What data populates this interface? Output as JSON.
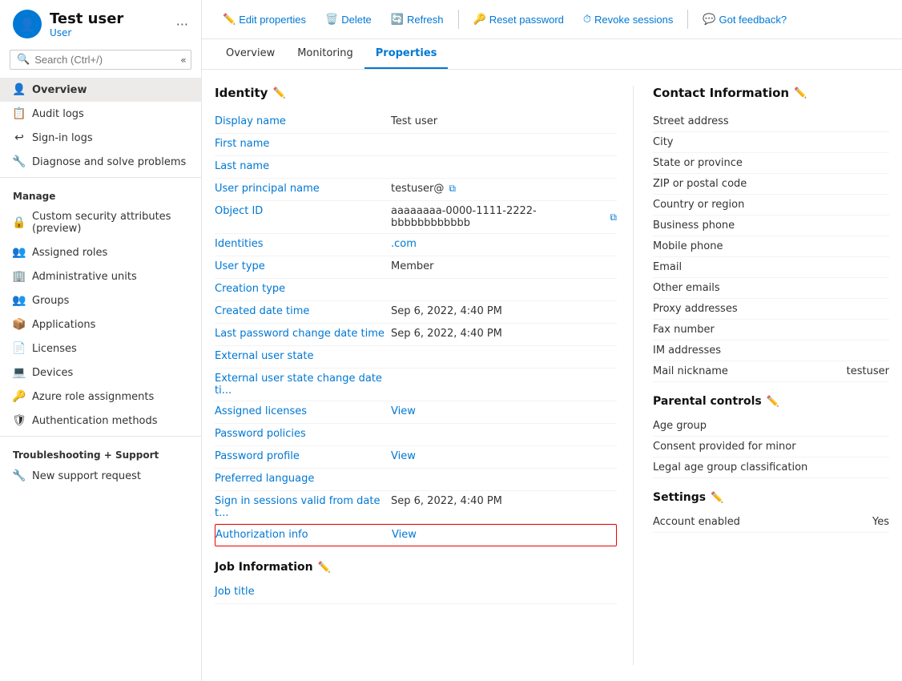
{
  "sidebar": {
    "username": "Test user",
    "subtitle": "User",
    "more_icon": "···",
    "search_placeholder": "Search (Ctrl+/)",
    "nav_items": [
      {
        "id": "overview",
        "label": "Overview",
        "icon": "👤",
        "active": true
      },
      {
        "id": "audit-logs",
        "label": "Audit logs",
        "icon": "📋",
        "active": false
      },
      {
        "id": "sign-in-logs",
        "label": "Sign-in logs",
        "icon": "↩",
        "active": false
      },
      {
        "id": "diagnose",
        "label": "Diagnose and solve problems",
        "icon": "🔧",
        "active": false
      }
    ],
    "manage_label": "Manage",
    "manage_items": [
      {
        "id": "custom-security",
        "label": "Custom security attributes (preview)",
        "icon": "🔒"
      },
      {
        "id": "assigned-roles",
        "label": "Assigned roles",
        "icon": "👥"
      },
      {
        "id": "admin-units",
        "label": "Administrative units",
        "icon": "🏢"
      },
      {
        "id": "groups",
        "label": "Groups",
        "icon": "👥"
      },
      {
        "id": "applications",
        "label": "Applications",
        "icon": "📦"
      },
      {
        "id": "licenses",
        "label": "Licenses",
        "icon": "📄"
      },
      {
        "id": "devices",
        "label": "Devices",
        "icon": "💻"
      },
      {
        "id": "azure-roles",
        "label": "Azure role assignments",
        "icon": "🔑"
      },
      {
        "id": "auth-methods",
        "label": "Authentication methods",
        "icon": "🛡"
      }
    ],
    "support_label": "Troubleshooting + Support",
    "support_items": [
      {
        "id": "new-support",
        "label": "New support request",
        "icon": "🔧"
      }
    ]
  },
  "toolbar": {
    "edit_label": "Edit properties",
    "delete_label": "Delete",
    "refresh_label": "Refresh",
    "reset_password_label": "Reset password",
    "revoke_sessions_label": "Revoke sessions",
    "feedback_label": "Got feedback?"
  },
  "tabs": [
    {
      "id": "overview",
      "label": "Overview",
      "active": false
    },
    {
      "id": "monitoring",
      "label": "Monitoring",
      "active": false
    },
    {
      "id": "properties",
      "label": "Properties",
      "active": true
    }
  ],
  "identity": {
    "section_title": "Identity",
    "fields": [
      {
        "label": "Display name",
        "value": "Test user",
        "link": false,
        "copy": false
      },
      {
        "label": "First name",
        "value": "",
        "link": false,
        "copy": false
      },
      {
        "label": "Last name",
        "value": "",
        "link": false,
        "copy": false
      },
      {
        "label": "User principal name",
        "value": "testuser@",
        "link": false,
        "copy": true
      },
      {
        "label": "Object ID",
        "value": "aaaaaaaa-0000-1111-2222-bbbbbbbbbbbb",
        "link": false,
        "copy": true
      },
      {
        "label": "Identities",
        "value": ".com",
        "link": false,
        "copy": false,
        "special": "identities"
      },
      {
        "label": "User type",
        "value": "Member",
        "link": false,
        "copy": false
      },
      {
        "label": "Creation type",
        "value": "",
        "link": false,
        "copy": false
      },
      {
        "label": "Created date time",
        "value": "Sep 6, 2022, 4:40 PM",
        "link": false,
        "copy": false
      },
      {
        "label": "Last password change date time",
        "value": "Sep 6, 2022, 4:40 PM",
        "link": false,
        "copy": false
      },
      {
        "label": "External user state",
        "value": "",
        "link": false,
        "copy": false
      },
      {
        "label": "External user state change date ti...",
        "value": "",
        "link": false,
        "copy": false
      },
      {
        "label": "Assigned licenses",
        "value": "View",
        "link": true,
        "copy": false
      },
      {
        "label": "Password policies",
        "value": "",
        "link": false,
        "copy": false
      },
      {
        "label": "Password profile",
        "value": "View",
        "link": true,
        "copy": false
      },
      {
        "label": "Preferred language",
        "value": "",
        "link": false,
        "copy": false
      },
      {
        "label": "Sign in sessions valid from date t...",
        "value": "Sep 6, 2022, 4:40 PM",
        "link": false,
        "copy": false
      },
      {
        "label": "Authorization info",
        "value": "View",
        "link": true,
        "copy": false,
        "highlighted": true
      }
    ]
  },
  "job_info": {
    "section_title": "Job Information",
    "fields": [
      {
        "label": "Job title",
        "value": "",
        "link": false
      }
    ]
  },
  "contact": {
    "section_title": "Contact Information",
    "fields": [
      {
        "label": "Street address",
        "value": ""
      },
      {
        "label": "City",
        "value": ""
      },
      {
        "label": "State or province",
        "value": ""
      },
      {
        "label": "ZIP or postal code",
        "value": ""
      },
      {
        "label": "Country or region",
        "value": ""
      },
      {
        "label": "Business phone",
        "value": ""
      },
      {
        "label": "Mobile phone",
        "value": ""
      },
      {
        "label": "Email",
        "value": ""
      },
      {
        "label": "Other emails",
        "value": ""
      },
      {
        "label": "Proxy addresses",
        "value": ""
      },
      {
        "label": "Fax number",
        "value": ""
      },
      {
        "label": "IM addresses",
        "value": ""
      },
      {
        "label": "Mail nickname",
        "value": "testuser"
      }
    ]
  },
  "parental": {
    "section_title": "Parental controls",
    "fields": [
      {
        "label": "Age group",
        "value": ""
      },
      {
        "label": "Consent provided for minor",
        "value": ""
      },
      {
        "label": "Legal age group classification",
        "value": ""
      }
    ]
  },
  "settings": {
    "section_title": "Settings",
    "fields": [
      {
        "label": "Account enabled",
        "value": "Yes"
      }
    ]
  }
}
